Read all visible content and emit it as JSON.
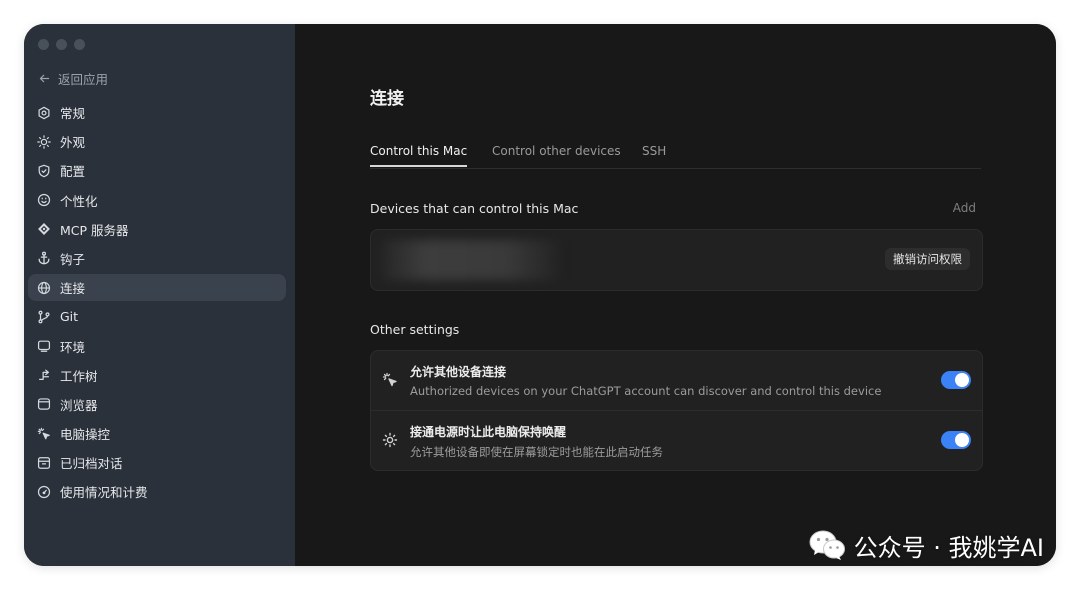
{
  "sidebar": {
    "back_label": "返回应用",
    "items": [
      {
        "label": "常规",
        "icon": "gear-icon"
      },
      {
        "label": "外观",
        "icon": "sun-icon"
      },
      {
        "label": "配置",
        "icon": "shield-icon"
      },
      {
        "label": "个性化",
        "icon": "face-icon"
      },
      {
        "label": "MCP 服务器",
        "icon": "plug-icon"
      },
      {
        "label": "钩子",
        "icon": "anchor-icon"
      },
      {
        "label": "连接",
        "icon": "globe-icon",
        "active": true
      },
      {
        "label": "Git",
        "icon": "git-branch-icon"
      },
      {
        "label": "环境",
        "icon": "monitor-icon"
      },
      {
        "label": "工作树",
        "icon": "worktree-icon"
      },
      {
        "label": "浏览器",
        "icon": "browser-icon"
      },
      {
        "label": "电脑操控",
        "icon": "cursor-sparkle-icon"
      },
      {
        "label": "已归档对话",
        "icon": "archive-icon"
      },
      {
        "label": "使用情况和计费",
        "icon": "gauge-icon"
      }
    ]
  },
  "main": {
    "title": "连接",
    "tabs": [
      {
        "label": "Control this Mac",
        "active": true
      },
      {
        "label": "Control other devices",
        "active": false
      },
      {
        "label": "SSH",
        "active": false
      }
    ],
    "devices_section": {
      "label": "Devices that can control this Mac",
      "add_label": "Add",
      "revoke_label": "撤销访问权限",
      "device_name": "▏"
    },
    "other_settings": {
      "label": "Other settings",
      "items": [
        {
          "title": "允许其他设备连接",
          "description": "Authorized devices on your ChatGPT account can discover and control this device",
          "icon": "cursor-sparkle-icon",
          "enabled": true
        },
        {
          "title": "接通电源时让此电脑保持唤醒",
          "description": "允许其他设备即使在屏幕锁定时也能在此启动任务",
          "icon": "sun-icon",
          "enabled": true
        }
      ]
    }
  },
  "watermark": {
    "text": "公众号 · 我姚学AI",
    "icon": "wechat-icon"
  },
  "colors": {
    "sidebar_bg": "#2a313a",
    "main_bg": "#181818",
    "accent": "#3b82f6"
  }
}
